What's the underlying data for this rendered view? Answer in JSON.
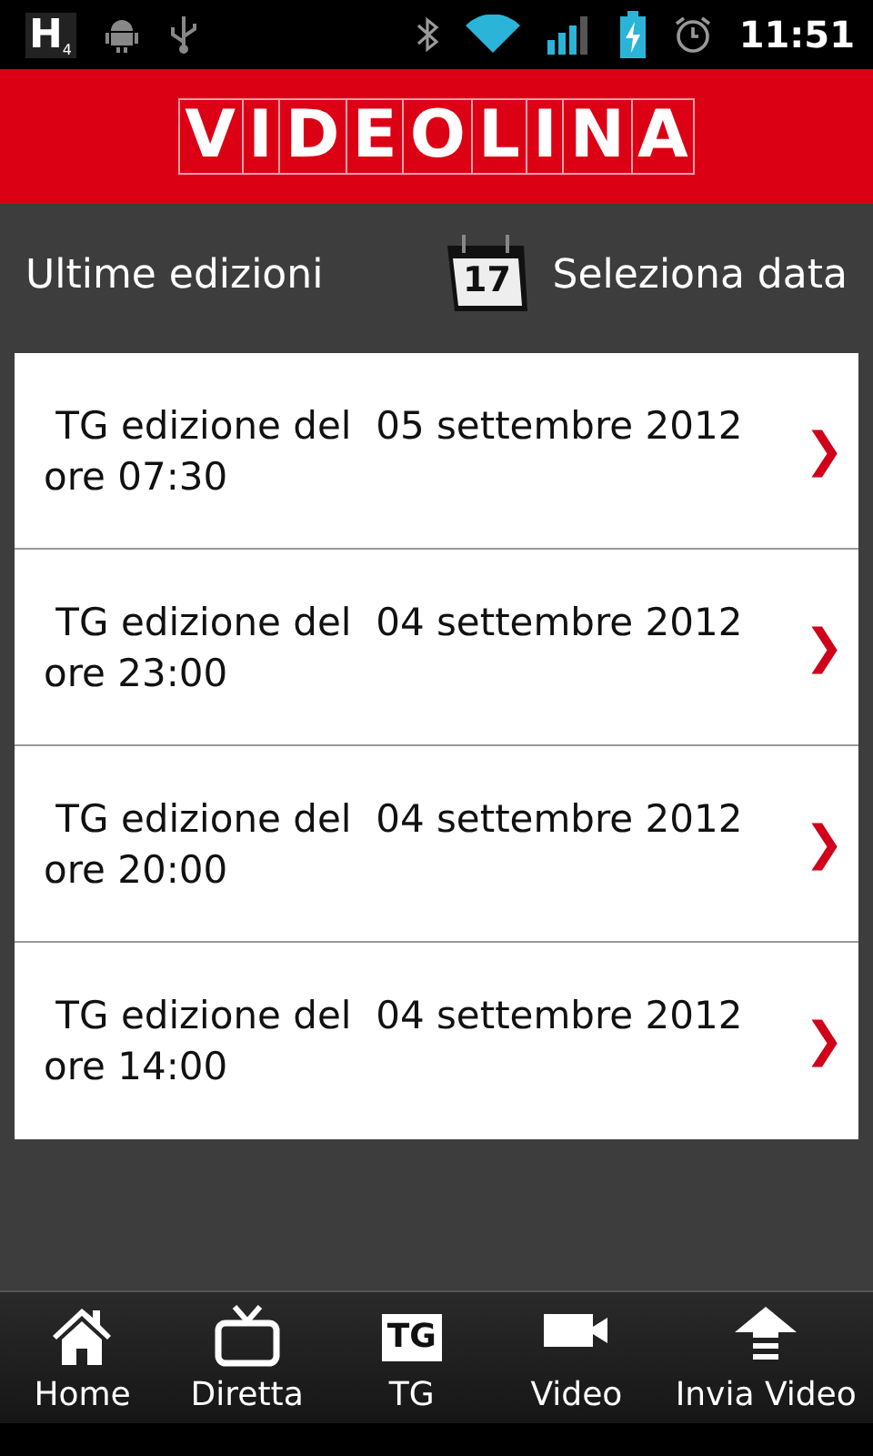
{
  "status_bar": {
    "network": "H",
    "network_sub": "4",
    "time": "11:51"
  },
  "header": {
    "logo": "VIDEOLINA"
  },
  "toolbar": {
    "title": "Ultime edizioni",
    "calendar_day": "17",
    "action": "Seleziona data"
  },
  "editions": [
    {
      "title": " TG edizione del  05 settembre 2012",
      "time": "ore 07:30",
      "chevron": "❯"
    },
    {
      "title": " TG edizione del  04 settembre 2012",
      "time": "ore 23:00",
      "chevron": "❯"
    },
    {
      "title": " TG edizione del  04 settembre 2012",
      "time": "ore 20:00",
      "chevron": "❯"
    },
    {
      "title": " TG edizione del  04 settembre 2012",
      "time": "ore 14:00",
      "chevron": "❯"
    }
  ],
  "nav": [
    {
      "kind": "home",
      "label": "Home"
    },
    {
      "kind": "tv",
      "label": "Diretta"
    },
    {
      "kind": "tg",
      "label": "TG",
      "icon_text": "TG"
    },
    {
      "kind": "camera",
      "label": "Video"
    },
    {
      "kind": "upload",
      "label": "Invia Video"
    }
  ]
}
